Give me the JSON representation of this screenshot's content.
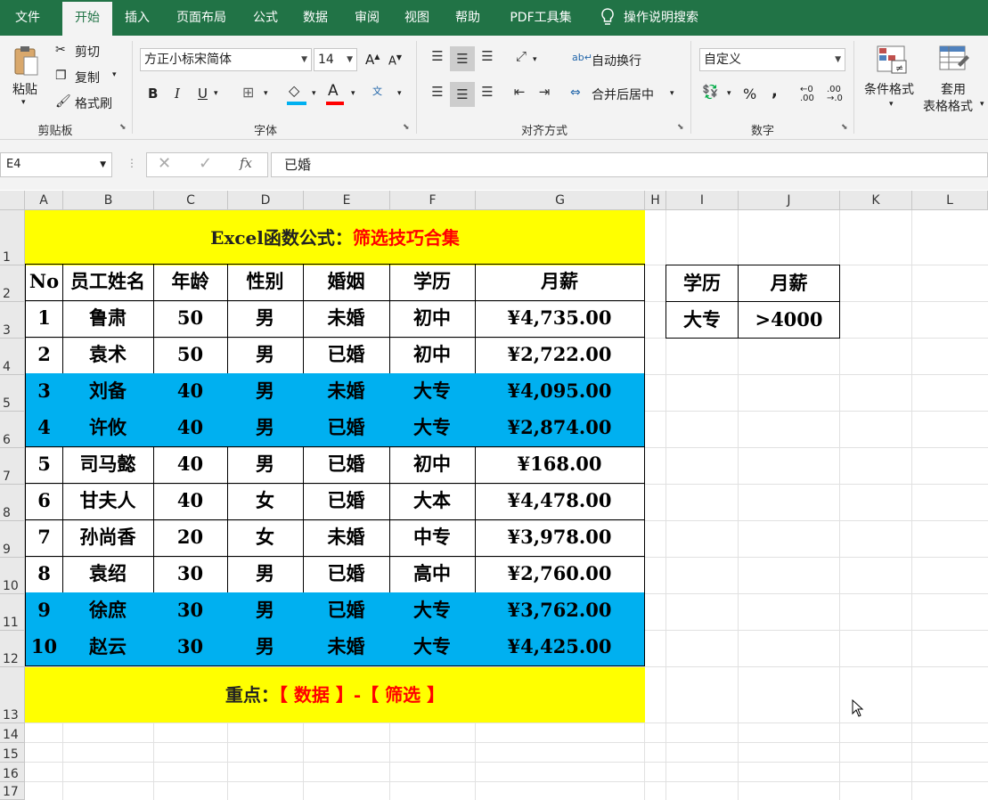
{
  "menu": {
    "tabs": [
      "文件",
      "开始",
      "插入",
      "页面布局",
      "公式",
      "数据",
      "审阅",
      "视图",
      "帮助",
      "PDF工具集"
    ],
    "tell_me": "操作说明搜索"
  },
  "ribbon": {
    "paste": "粘贴",
    "cut": "剪切",
    "copy": "复制",
    "format_painter": "格式刷",
    "clipboard_label": "剪贴板",
    "font_name": "方正小标宋简体",
    "font_size": "14",
    "bold": "B",
    "italic": "I",
    "underline": "U",
    "font_label": "字体",
    "wrap_text": "自动换行",
    "merge_center": "合并后居中",
    "align_label": "对齐方式",
    "number_format": "自定义",
    "percent": "%",
    "comma": ",",
    "number_label": "数字",
    "conditional_format": "条件格式",
    "table_format_1": "套用",
    "table_format_2": "表格格式"
  },
  "formula_bar": {
    "name_box": "E4",
    "fx": "fx",
    "value": "已婚"
  },
  "colors": {
    "excel_green": "#217346",
    "highlight_blue": "#00b0f0",
    "title_yellow": "#ffff00",
    "red": "#ff0000"
  },
  "sheet": {
    "columns": [
      "A",
      "B",
      "C",
      "D",
      "E",
      "F",
      "G",
      "H",
      "I",
      "J",
      "K",
      "L"
    ],
    "rows": [
      "1",
      "2",
      "3",
      "4",
      "5",
      "6",
      "7",
      "8",
      "9",
      "10",
      "11",
      "12",
      "13",
      "14",
      "15",
      "16",
      "17"
    ],
    "title_black": "Excel函数公式：",
    "title_red": "筛选技巧合集",
    "headers": [
      "No",
      "员工姓名",
      "年龄",
      "性别",
      "婚姻",
      "学历",
      "月薪"
    ],
    "data_rows": [
      {
        "no": "1",
        "name": "鲁肃",
        "age": "50",
        "gender": "男",
        "marriage": "未婚",
        "edu": "初中",
        "salary": "¥4,735.00",
        "highlight": false
      },
      {
        "no": "2",
        "name": "袁术",
        "age": "50",
        "gender": "男",
        "marriage": "已婚",
        "edu": "初中",
        "salary": "¥2,722.00",
        "highlight": false
      },
      {
        "no": "3",
        "name": "刘备",
        "age": "40",
        "gender": "男",
        "marriage": "未婚",
        "edu": "大专",
        "salary": "¥4,095.00",
        "highlight": true
      },
      {
        "no": "4",
        "name": "许攸",
        "age": "40",
        "gender": "男",
        "marriage": "已婚",
        "edu": "大专",
        "salary": "¥2,874.00",
        "highlight": true
      },
      {
        "no": "5",
        "name": "司马懿",
        "age": "40",
        "gender": "男",
        "marriage": "已婚",
        "edu": "初中",
        "salary": "¥168.00",
        "highlight": false
      },
      {
        "no": "6",
        "name": "甘夫人",
        "age": "40",
        "gender": "女",
        "marriage": "已婚",
        "edu": "大本",
        "salary": "¥4,478.00",
        "highlight": false
      },
      {
        "no": "7",
        "name": "孙尚香",
        "age": "20",
        "gender": "女",
        "marriage": "未婚",
        "edu": "中专",
        "salary": "¥3,978.00",
        "highlight": false
      },
      {
        "no": "8",
        "name": "袁绍",
        "age": "30",
        "gender": "男",
        "marriage": "已婚",
        "edu": "高中",
        "salary": "¥2,760.00",
        "highlight": false
      },
      {
        "no": "9",
        "name": "徐庶",
        "age": "30",
        "gender": "男",
        "marriage": "已婚",
        "edu": "大专",
        "salary": "¥3,762.00",
        "highlight": true
      },
      {
        "no": "10",
        "name": "赵云",
        "age": "30",
        "gender": "男",
        "marriage": "未婚",
        "edu": "大专",
        "salary": "¥4,425.00",
        "highlight": true
      }
    ],
    "criteria_headers": [
      "学历",
      "月薪"
    ],
    "criteria_values": [
      "大专",
      ">4000"
    ],
    "footer_black": "重点：",
    "footer_red": "【 数据 】-【 筛选 】"
  }
}
